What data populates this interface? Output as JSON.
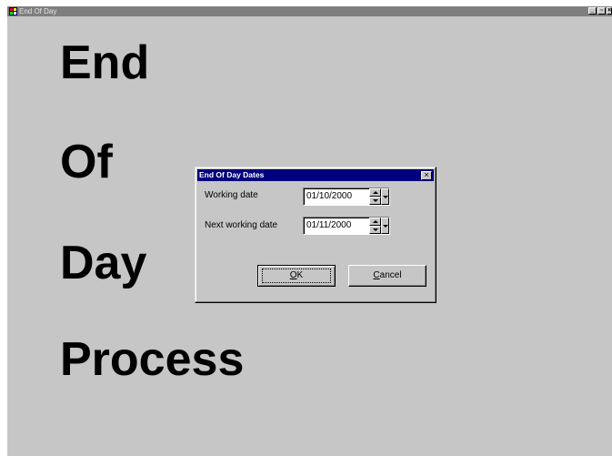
{
  "window": {
    "title": "End Of Day",
    "controls": {
      "minimize": "_",
      "maximize": "▫",
      "close": "×"
    }
  },
  "background_text": {
    "lines": [
      "End",
      "Of",
      "Day",
      "Process"
    ]
  },
  "dialog": {
    "title": "End Of Day Dates",
    "close": "×",
    "fields": [
      {
        "label": "Working date",
        "value": "01/10/2000"
      },
      {
        "label": "Next working date",
        "value": "01/11/2000"
      }
    ],
    "ok": {
      "mnemonic": "O",
      "rest": "K"
    },
    "cancel": {
      "mnemonic": "C",
      "rest": "ancel"
    }
  },
  "icons": {
    "app_icon": "app-icon",
    "spin_up": "arrow-up",
    "spin_down": "arrow-down",
    "dropdown": "chevron-down"
  },
  "colors": {
    "dialog_title_bg": "#00007f",
    "window_title_bg": "#7f7f7f",
    "face": "#c6c6c6"
  }
}
